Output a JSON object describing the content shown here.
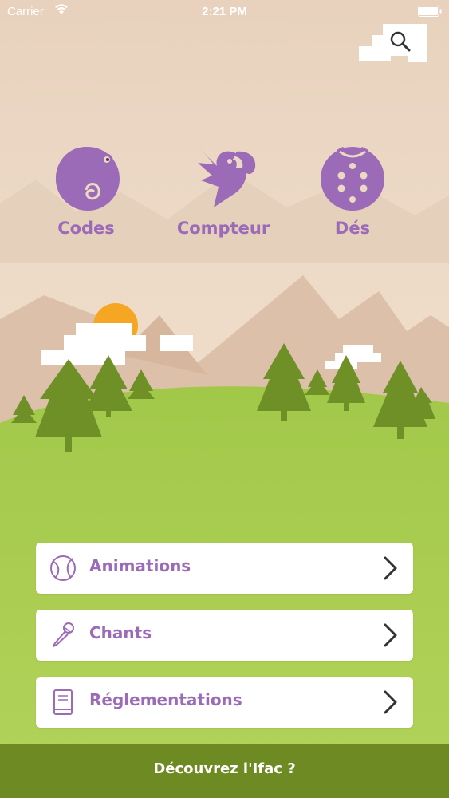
{
  "status_bar": {
    "carrier": "Carrier",
    "time": "2:21 PM"
  },
  "search": {
    "icon": "search-icon"
  },
  "modes": [
    {
      "label": "Codes",
      "icon": "chameleon-icon"
    },
    {
      "label": "Compteur",
      "icon": "parrot-icon"
    },
    {
      "label": "Dés",
      "icon": "ladybug-dice-icon"
    }
  ],
  "menu": [
    {
      "label": "Animations",
      "icon": "ball-icon"
    },
    {
      "label": "Chants",
      "icon": "microphone-icon"
    },
    {
      "label": "Réglementations",
      "icon": "book-icon"
    }
  ],
  "footer": {
    "label": "Découvrez l'Ifac ?"
  },
  "colors": {
    "accent_purple": "#9b6bb8",
    "grass": "#a9cc4f",
    "footer_green": "#6e8a22",
    "tree": "#6e9027",
    "sun": "#f5a623"
  }
}
